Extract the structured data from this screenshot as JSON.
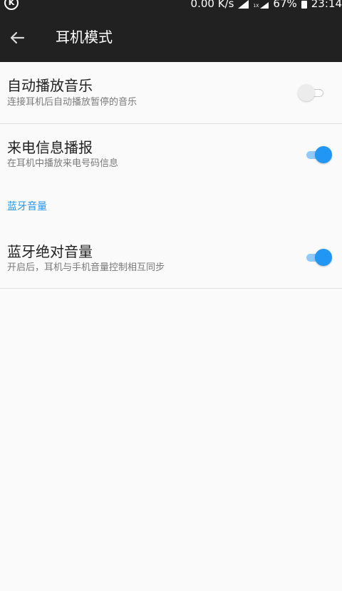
{
  "status_bar": {
    "net_speed": "0.00 K/s",
    "sim2_label": "1X",
    "battery": "67%",
    "time": "23:14",
    "app_icon": "k-circle-icon"
  },
  "toolbar": {
    "title": "耳机模式",
    "back_icon": "arrow-back-icon"
  },
  "settings": [
    {
      "title": "自动播放音乐",
      "subtitle": "连接耳机后自动播放暂停的音乐",
      "enabled": false
    },
    {
      "title": "来电信息播报",
      "subtitle": "在耳机中播放来电号码信息",
      "enabled": true
    }
  ],
  "section_header": "蓝牙音量",
  "bluetooth_settings": [
    {
      "title": "蓝牙绝对音量",
      "subtitle": "开启后，耳机与手机音量控制相互同步",
      "enabled": true
    }
  ],
  "colors": {
    "accent": "#2196f3",
    "toolbar_bg": "#212121",
    "page_bg": "#fafafa"
  }
}
